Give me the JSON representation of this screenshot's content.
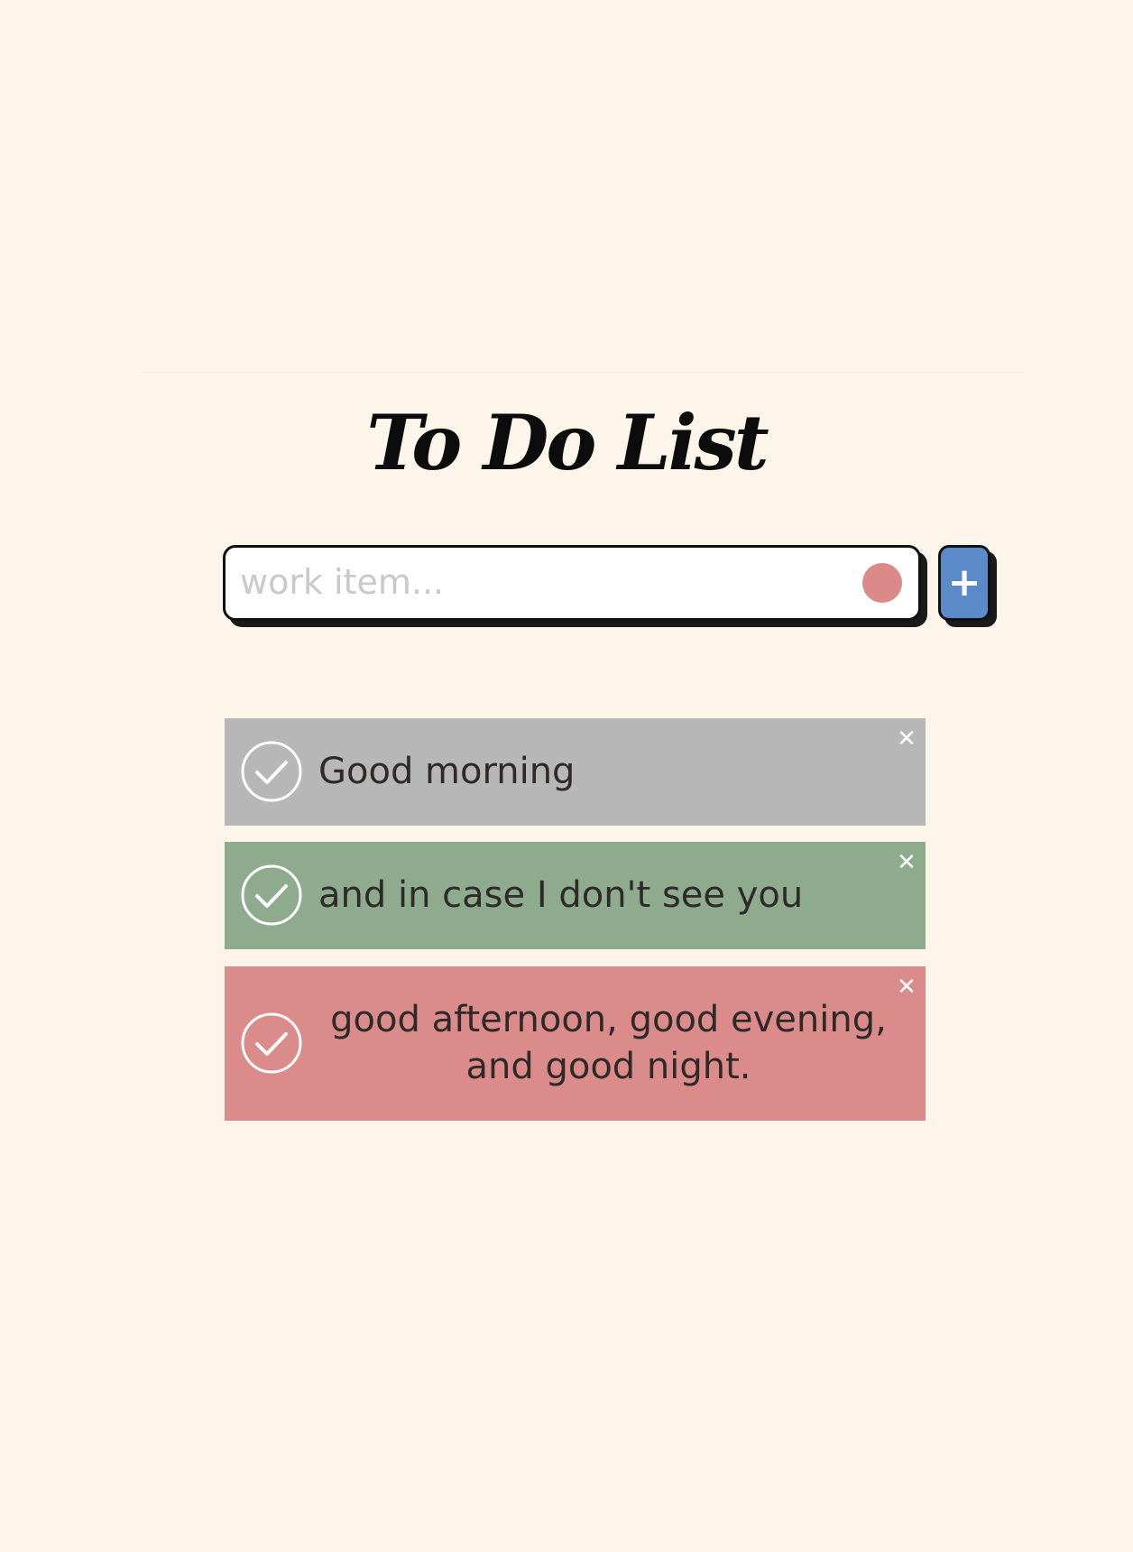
{
  "title": "To Do List",
  "input": {
    "placeholder": "work item...",
    "value": "",
    "color_dot": "#dc8a89"
  },
  "add_button": {
    "label": "+",
    "color": "#5a8bc8"
  },
  "items": [
    {
      "text": "Good morning",
      "color": "#b7b7b7",
      "delete_label": "✕"
    },
    {
      "text": "and in case I don't see you",
      "color": "#8fab8e",
      "delete_label": "✕"
    },
    {
      "text": "good afternoon, good evening, and good night.",
      "color": "#db8b8a",
      "delete_label": "✕"
    }
  ],
  "colors": {
    "background": "#fdf5ea",
    "check_icon": "#ffffff",
    "text": "#2f2a2a"
  }
}
